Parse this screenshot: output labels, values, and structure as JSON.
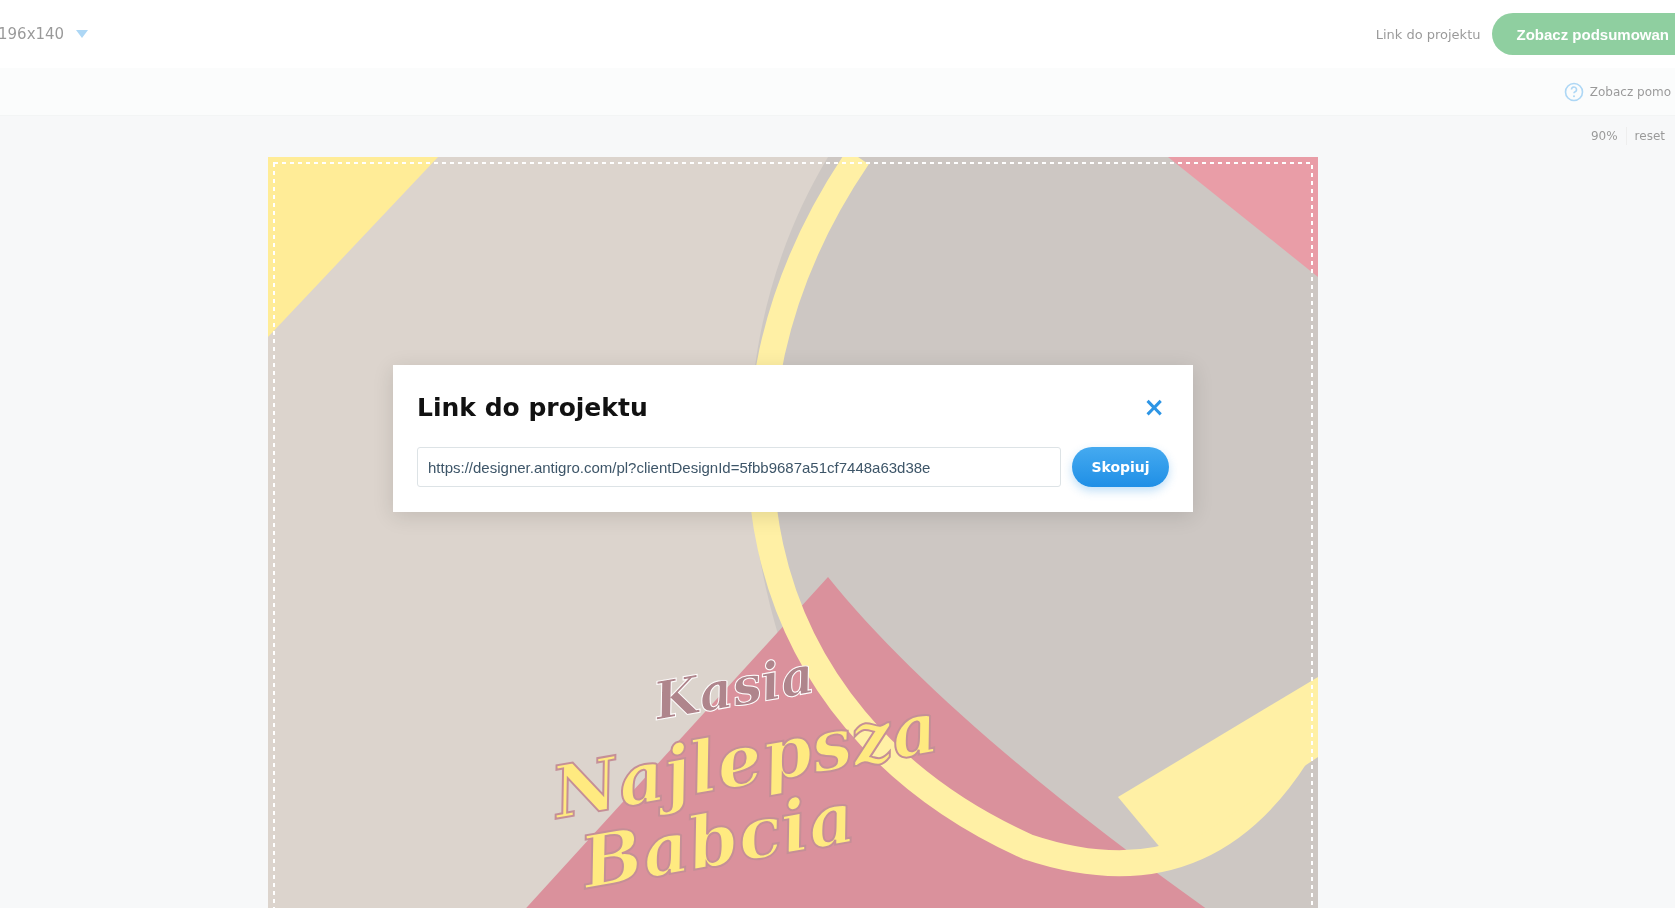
{
  "top_bar": {
    "size_label": "196x140",
    "link_label": "Link do projektu",
    "summary_button": "Zobacz podsumowan"
  },
  "toolbar": {
    "help_label": "Zobacz pomo"
  },
  "zoom": {
    "value": "90%",
    "reset": "reset"
  },
  "design": {
    "texts": [
      {
        "kind": "name",
        "text": "Kasia"
      },
      {
        "kind": "headline",
        "text": "Najlepsza"
      },
      {
        "kind": "headline2",
        "text": "Babcia"
      }
    ]
  },
  "dialog": {
    "title": "Link do projektu",
    "close": "×",
    "url": "https://designer.antigro.com/pl?clientDesignId=5fbb9687a51cf7448a63d38e",
    "copy_button": "Skopiuj"
  }
}
